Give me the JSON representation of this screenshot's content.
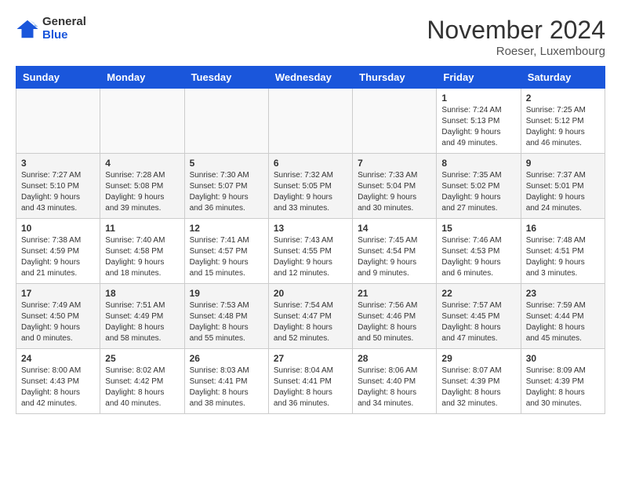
{
  "logo": {
    "general": "General",
    "blue": "Blue"
  },
  "title": "November 2024",
  "location": "Roeser, Luxembourg",
  "headers": [
    "Sunday",
    "Monday",
    "Tuesday",
    "Wednesday",
    "Thursday",
    "Friday",
    "Saturday"
  ],
  "weeks": [
    [
      {
        "day": "",
        "info": ""
      },
      {
        "day": "",
        "info": ""
      },
      {
        "day": "",
        "info": ""
      },
      {
        "day": "",
        "info": ""
      },
      {
        "day": "",
        "info": ""
      },
      {
        "day": "1",
        "info": "Sunrise: 7:24 AM\nSunset: 5:13 PM\nDaylight: 9 hours\nand 49 minutes."
      },
      {
        "day": "2",
        "info": "Sunrise: 7:25 AM\nSunset: 5:12 PM\nDaylight: 9 hours\nand 46 minutes."
      }
    ],
    [
      {
        "day": "3",
        "info": "Sunrise: 7:27 AM\nSunset: 5:10 PM\nDaylight: 9 hours\nand 43 minutes."
      },
      {
        "day": "4",
        "info": "Sunrise: 7:28 AM\nSunset: 5:08 PM\nDaylight: 9 hours\nand 39 minutes."
      },
      {
        "day": "5",
        "info": "Sunrise: 7:30 AM\nSunset: 5:07 PM\nDaylight: 9 hours\nand 36 minutes."
      },
      {
        "day": "6",
        "info": "Sunrise: 7:32 AM\nSunset: 5:05 PM\nDaylight: 9 hours\nand 33 minutes."
      },
      {
        "day": "7",
        "info": "Sunrise: 7:33 AM\nSunset: 5:04 PM\nDaylight: 9 hours\nand 30 minutes."
      },
      {
        "day": "8",
        "info": "Sunrise: 7:35 AM\nSunset: 5:02 PM\nDaylight: 9 hours\nand 27 minutes."
      },
      {
        "day": "9",
        "info": "Sunrise: 7:37 AM\nSunset: 5:01 PM\nDaylight: 9 hours\nand 24 minutes."
      }
    ],
    [
      {
        "day": "10",
        "info": "Sunrise: 7:38 AM\nSunset: 4:59 PM\nDaylight: 9 hours\nand 21 minutes."
      },
      {
        "day": "11",
        "info": "Sunrise: 7:40 AM\nSunset: 4:58 PM\nDaylight: 9 hours\nand 18 minutes."
      },
      {
        "day": "12",
        "info": "Sunrise: 7:41 AM\nSunset: 4:57 PM\nDaylight: 9 hours\nand 15 minutes."
      },
      {
        "day": "13",
        "info": "Sunrise: 7:43 AM\nSunset: 4:55 PM\nDaylight: 9 hours\nand 12 minutes."
      },
      {
        "day": "14",
        "info": "Sunrise: 7:45 AM\nSunset: 4:54 PM\nDaylight: 9 hours\nand 9 minutes."
      },
      {
        "day": "15",
        "info": "Sunrise: 7:46 AM\nSunset: 4:53 PM\nDaylight: 9 hours\nand 6 minutes."
      },
      {
        "day": "16",
        "info": "Sunrise: 7:48 AM\nSunset: 4:51 PM\nDaylight: 9 hours\nand 3 minutes."
      }
    ],
    [
      {
        "day": "17",
        "info": "Sunrise: 7:49 AM\nSunset: 4:50 PM\nDaylight: 9 hours\nand 0 minutes."
      },
      {
        "day": "18",
        "info": "Sunrise: 7:51 AM\nSunset: 4:49 PM\nDaylight: 8 hours\nand 58 minutes."
      },
      {
        "day": "19",
        "info": "Sunrise: 7:53 AM\nSunset: 4:48 PM\nDaylight: 8 hours\nand 55 minutes."
      },
      {
        "day": "20",
        "info": "Sunrise: 7:54 AM\nSunset: 4:47 PM\nDaylight: 8 hours\nand 52 minutes."
      },
      {
        "day": "21",
        "info": "Sunrise: 7:56 AM\nSunset: 4:46 PM\nDaylight: 8 hours\nand 50 minutes."
      },
      {
        "day": "22",
        "info": "Sunrise: 7:57 AM\nSunset: 4:45 PM\nDaylight: 8 hours\nand 47 minutes."
      },
      {
        "day": "23",
        "info": "Sunrise: 7:59 AM\nSunset: 4:44 PM\nDaylight: 8 hours\nand 45 minutes."
      }
    ],
    [
      {
        "day": "24",
        "info": "Sunrise: 8:00 AM\nSunset: 4:43 PM\nDaylight: 8 hours\nand 42 minutes."
      },
      {
        "day": "25",
        "info": "Sunrise: 8:02 AM\nSunset: 4:42 PM\nDaylight: 8 hours\nand 40 minutes."
      },
      {
        "day": "26",
        "info": "Sunrise: 8:03 AM\nSunset: 4:41 PM\nDaylight: 8 hours\nand 38 minutes."
      },
      {
        "day": "27",
        "info": "Sunrise: 8:04 AM\nSunset: 4:41 PM\nDaylight: 8 hours\nand 36 minutes."
      },
      {
        "day": "28",
        "info": "Sunrise: 8:06 AM\nSunset: 4:40 PM\nDaylight: 8 hours\nand 34 minutes."
      },
      {
        "day": "29",
        "info": "Sunrise: 8:07 AM\nSunset: 4:39 PM\nDaylight: 8 hours\nand 32 minutes."
      },
      {
        "day": "30",
        "info": "Sunrise: 8:09 AM\nSunset: 4:39 PM\nDaylight: 8 hours\nand 30 minutes."
      }
    ]
  ]
}
